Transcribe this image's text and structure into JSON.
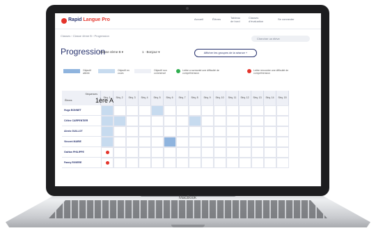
{
  "device": {
    "brand": "MacBook"
  },
  "app": {
    "logo_main": "Rapid",
    "logo_accent": "Langue Pro",
    "nav": [
      "Accueil",
      "Élèves",
      "Tableau\nde bord",
      "Classes\nd'évaluation",
      "Se connecter"
    ]
  },
  "breadcrumb": "Classes › Classe 4ème B › Progression",
  "search_placeholder": "Chercher un élève",
  "page_title": "Progression",
  "filters": {
    "class_select": "Classe 4ème B",
    "lesson_select": "1 · Bonjour"
  },
  "toggle_label": "Afficher les groupes de la séance",
  "toggle_symbol": "+",
  "legend": [
    {
      "label": "Objectif\natteint",
      "color": "#8fb4de"
    },
    {
      "label": "Objectif en\ncours",
      "color": "#c7dbef"
    },
    {
      "label": "Objectif non\ncommencé",
      "color": "#eef0f6"
    },
    {
      "label": "Lettre a surmonté une difficulté de\ncompréhension",
      "color": "#2fae4f"
    },
    {
      "label": "Lettre rencontre une difficulté de\ncompréhension",
      "color": "#e4342b"
    }
  ],
  "table": {
    "corner_top": "Séquences",
    "corner_bottom": "Élèves",
    "columns": [
      "Séq. 1",
      "Séq. 2",
      "Séq. 3",
      "Séq. 4",
      "Séq. 5",
      "Séq. 6",
      "Séq. 7",
      "Séq. 8",
      "Séq. 9",
      "Séq. 10",
      "Séq. 11",
      "Séq. 12",
      "Séq. 13",
      "Séq. 14",
      "Séq. 15"
    ],
    "rows": [
      {
        "name": "Hugo BONNET",
        "cells": [
          "l",
          "",
          "",
          "",
          "l",
          "",
          "",
          "",
          "",
          "",
          "",
          "",
          "",
          "",
          ""
        ]
      },
      {
        "name": "Céline CARPENTIER",
        "cells": [
          "l",
          "l",
          "",
          "",
          "",
          "",
          "",
          "l",
          "",
          "",
          "",
          "",
          "",
          "",
          ""
        ]
      },
      {
        "name": "Alexis GUILLOT",
        "cells": [
          "l",
          "",
          "",
          "",
          "",
          "",
          "",
          "",
          "",
          "",
          "",
          "",
          "",
          "",
          ""
        ]
      },
      {
        "name": "Vincent MARIE",
        "cells": [
          "l",
          "",
          "",
          "",
          "",
          "d",
          "",
          "",
          "",
          "",
          "",
          "",
          "",
          "",
          ""
        ]
      },
      {
        "name": "Gaëtan PHILIPPE",
        "cells": [
          "r",
          "",
          "",
          "",
          "",
          "",
          "",
          "",
          "",
          "",
          "",
          "",
          "",
          "",
          ""
        ]
      },
      {
        "name": "Fanny RIVIERE",
        "cells": [
          "r",
          "",
          "",
          "",
          "",
          "",
          "",
          "",
          "",
          "",
          "",
          "",
          "",
          "",
          ""
        ]
      }
    ]
  },
  "tooltip": "1ère A"
}
